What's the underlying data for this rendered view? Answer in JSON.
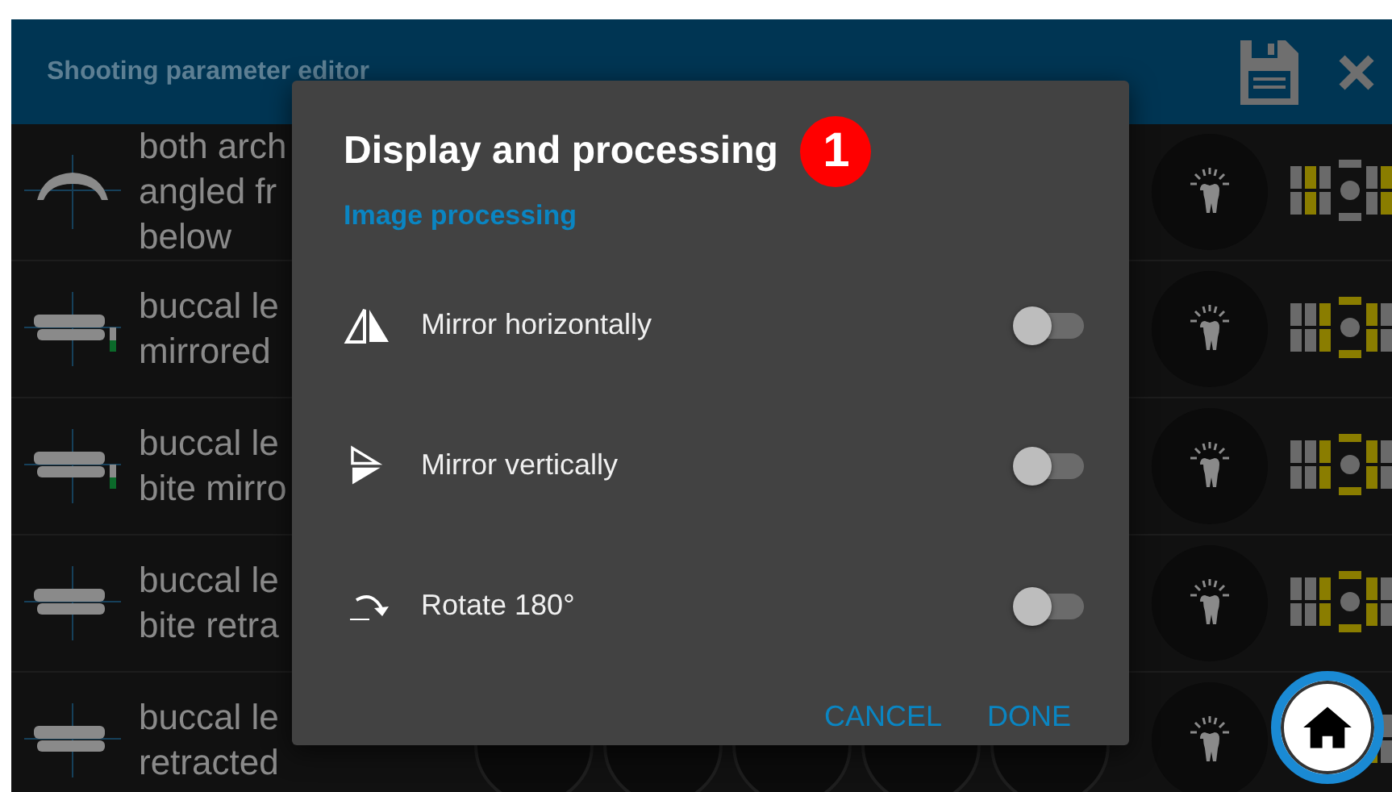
{
  "header": {
    "title": "Shooting parameter editor"
  },
  "rows": [
    {
      "kind": "arch",
      "lines": [
        "both arch",
        "angled fr",
        "below"
      ]
    },
    {
      "kind": "buccal-marked",
      "lines": [
        "buccal le",
        "mirrored"
      ]
    },
    {
      "kind": "buccal-marked",
      "lines": [
        "buccal le",
        "bite mirro"
      ]
    },
    {
      "kind": "buccal",
      "lines": [
        "buccal le",
        "bite retra"
      ]
    },
    {
      "kind": "buccal",
      "lines": [
        "buccal le",
        "retracted"
      ]
    }
  ],
  "dialog": {
    "title": "Display and processing",
    "badge": "1",
    "section": "Image processing",
    "options": [
      {
        "kind": "mirror-h",
        "label": "Mirror horizontally",
        "on": false
      },
      {
        "kind": "mirror-v",
        "label": "Mirror vertically",
        "on": false
      },
      {
        "kind": "rotate",
        "label": "Rotate 180°",
        "on": false
      }
    ],
    "buttons": [
      "CANCEL",
      "DONE"
    ]
  }
}
